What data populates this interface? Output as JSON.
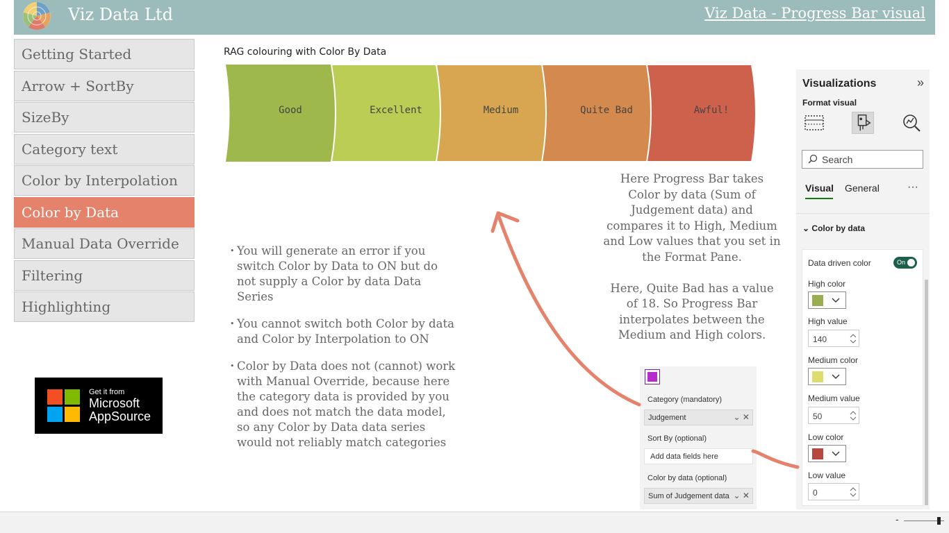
{
  "header": {
    "company": "Viz Data Ltd",
    "page_link": "Viz Data - Progress Bar visual",
    "background": "#9bbcbb",
    "logo_icon": "wheel-logo-icon"
  },
  "nav": {
    "items": [
      {
        "label": "Getting Started",
        "active": false
      },
      {
        "label": "Arrow + SortBy",
        "active": false
      },
      {
        "label": "SizeBy",
        "active": false
      },
      {
        "label": "Category text",
        "active": false
      },
      {
        "label": "Color by Interpolation",
        "active": false
      },
      {
        "label": "Color by Data",
        "active": true
      },
      {
        "label": "Manual Data Override",
        "active": false
      },
      {
        "label": "Filtering",
        "active": false
      },
      {
        "label": "Highlighting",
        "active": false
      }
    ],
    "active_color": "#e5826b"
  },
  "appsource": {
    "line1": "Get it from",
    "line2": "Microsoft",
    "line3": "AppSource"
  },
  "visual": {
    "title": "RAG colouring with Color By Data",
    "segments": [
      {
        "label": "Good",
        "color": "#9eb84c"
      },
      {
        "label": "Excellent",
        "color": "#bccd56"
      },
      {
        "label": "Medium",
        "color": "#d8a650"
      },
      {
        "label": "Quite Bad",
        "color": "#d48a4e"
      },
      {
        "label": "Awful!",
        "color": "#ce614b"
      }
    ]
  },
  "bullets": [
    "You will generate an error if you switch Color by Data to ON but do not supply a Color by data Data Series",
    "You cannot switch both Color by data and Color by Interpolation to ON",
    "Color by Data does not (cannot) work with Manual Override, because here the category data is provided by you and does not match the data model, so any Color by Data data series would not reliably match categories"
  ],
  "explanation": {
    "p1": "Here Progress Bar takes Color by data (Sum of Judgement data) and compares it to High, Medium and Low values that you set in the Format Pane.",
    "p2": "Here, Quite Bad has a value of 18. So Progress Bar interpolates between the Medium and High colors."
  },
  "wells": {
    "category_label": "Category (mandatory)",
    "category_field": "Judgement",
    "sortby_label": "Sort By (optional)",
    "sortby_placeholder": "Add data fields here",
    "colorby_label": "Color by data (optional)",
    "colorby_field": "Sum of Judgement data"
  },
  "vpane": {
    "title": "Visualizations",
    "subtitle": "Format visual",
    "search_placeholder": "Search",
    "tabs": [
      "Visual",
      "General"
    ],
    "active_tab": "Visual",
    "section": "Color by data",
    "data_driven_label": "Data driven color",
    "toggle_label": "On",
    "high_color_label": "High color",
    "high_color": "#9aae50",
    "high_value_label": "High value",
    "high_value": "140",
    "medium_color_label": "Medium color",
    "medium_color": "#dfdc6e",
    "medium_value_label": "Medium value",
    "medium_value": "50",
    "low_color_label": "Low color",
    "low_color": "#b8473f",
    "low_value_label": "Low value",
    "low_value": "0"
  },
  "statusbar": {
    "zoom_minus": "-"
  }
}
